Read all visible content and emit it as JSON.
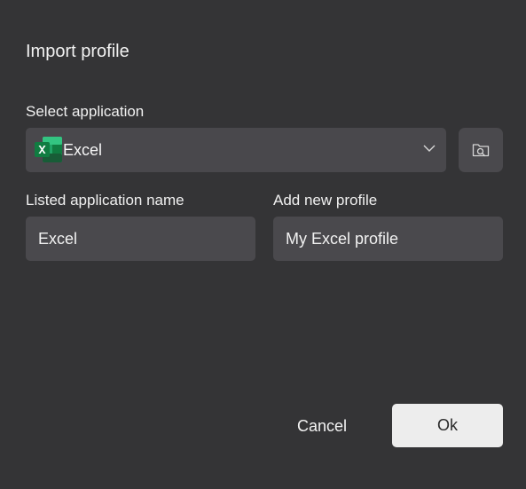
{
  "dialog": {
    "title": "Import profile"
  },
  "select_application": {
    "label": "Select application",
    "value": "Excel",
    "icon": "excel-icon"
  },
  "browse": {
    "icon": "folder-search-icon"
  },
  "listed_application": {
    "label": "Listed application name",
    "value": "Excel"
  },
  "new_profile": {
    "label": "Add new profile",
    "value": "My Excel profile"
  },
  "actions": {
    "cancel_label": "Cancel",
    "ok_label": "Ok"
  },
  "colors": {
    "background": "#343436",
    "field": "#4a494d",
    "ok_button": "#ededed",
    "excel_green": "#107c41"
  }
}
